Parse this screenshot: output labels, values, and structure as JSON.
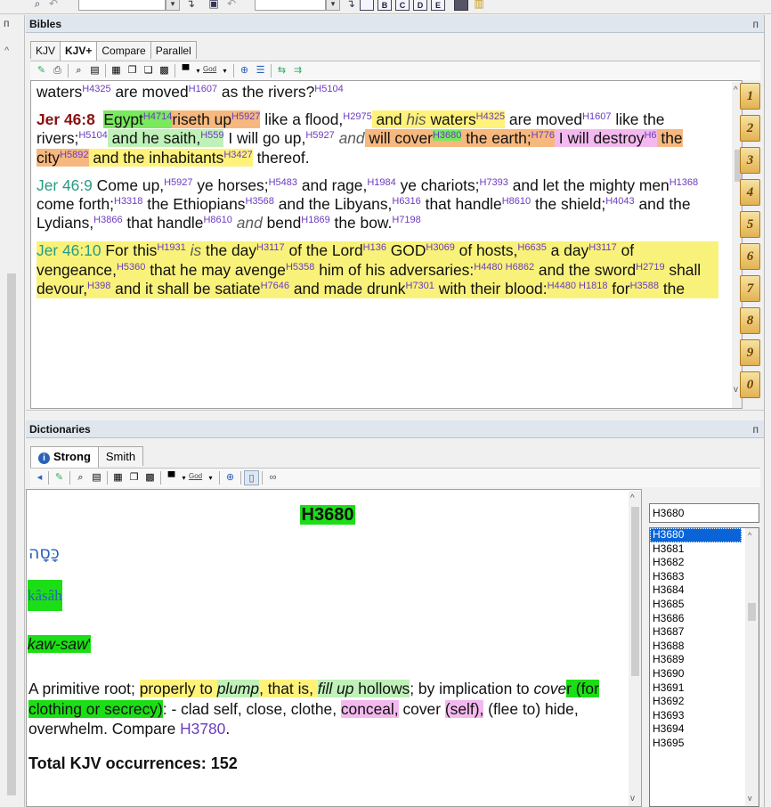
{
  "bibles_panel": {
    "title": "Bibles",
    "pin_glyph": "ᴨ",
    "tabs": [
      "KJV",
      "KJV+",
      "Compare",
      "Parallel"
    ],
    "god_label": "God",
    "verse_prev_tail": {
      "t1": "waters",
      "s1": "H4325",
      "t2": " are moved",
      "s2": "H1607",
      "t3": " as the rivers?",
      "s3": "H5104"
    },
    "v8": {
      "ref": "Jer 46:8",
      "p1": "Egypt",
      "p1s": "H4714",
      "p2": "riseth up",
      "p2s": "H5927",
      "p3": " like a flood,",
      "p3s": "H2975",
      "p4a": " and ",
      "p4b": "his",
      "p4c": " waters",
      "p4s": "H4325",
      "p5": " are moved",
      "p5s": "H1607",
      "p6": " like the rivers;",
      "p6s": "H5104",
      "p7": " and he saith,",
      "p7s": "H559",
      "p8": " I will go up,",
      "p8s": "H5927",
      "p9": " and",
      "p10": " will cover",
      "p10s": "H3680",
      "p11": " the earth;",
      "p11s": "H776",
      "p12": " I will destroy",
      "p12s": "H6",
      "p13": " the city",
      "p13s": "H5892",
      "p14": " and the inhabitants",
      "p14s": "H3427",
      "p15": " thereof."
    },
    "v9": {
      "ref": "Jer 46:9",
      "text_a": "  Come up,",
      "sa": "H5927",
      "text_b": " ye horses;",
      "sb": "H5483",
      "text_c": " and rage,",
      "sc": "H1984",
      "text_d": " ye chariots;",
      "sd": "H7393",
      "text_e": " and let the mighty men",
      "se": "H1368",
      "text_f": " come forth;",
      "sf": "H3318",
      "text_g": " the Ethiopians",
      "sg": "H3568",
      "text_h": " and the Libyans,",
      "sh": "H6316",
      "text_i": " that handle",
      "si": "H8610",
      "text_j": " the shield;",
      "sj": "H4043",
      "text_k": " and the Lydians,",
      "sk": "H3866",
      "text_l": " that handle",
      "sl": "H8610",
      "text_m": "and",
      "text_n": " bend",
      "sn": "H1869",
      "text_o": " the bow.",
      "so": "H7198"
    },
    "v10": {
      "ref": "Jer 46:10",
      "a": "  For this",
      "sa": "H1931",
      "b": "is",
      "c": " the day",
      "sc": "H3117",
      "d": " of the Lord",
      "sd": "H136",
      "e": " GOD",
      "se": "H3069",
      "f": " of hosts,",
      "sf": "H6635",
      "g": " a day",
      "sg": "H3117",
      "h": " of vengeance,",
      "sh": "H5360",
      "i": " that he may avenge",
      "si": "H5358",
      "j": " him of his adversaries:",
      "sj": "H4480 H6862",
      "k": " and the sword",
      "sk": "H2719",
      "l": " shall devour,",
      "sl": "H398",
      "m": " and it shall be satiate",
      "sm": "H7646",
      "n": " and made drunk",
      "sn": "H7301",
      "o": " with their blood:",
      "so": "H4480 H1818",
      "p": " for",
      "sp": "H3588",
      "q": " the"
    },
    "verse_buttons": [
      "1",
      "2",
      "3",
      "4",
      "5",
      "6",
      "7",
      "8",
      "9",
      "0"
    ]
  },
  "dict_panel": {
    "title": "Dictionaries",
    "tabs": [
      "Strong",
      "Smith"
    ],
    "info_glyph": "i",
    "entry_id": "H3680",
    "hebrew": "כָּסָה",
    "translit": "kâsâh",
    "pronunciation": "kaw-saw",
    "pron_mark": "'",
    "definition": {
      "a": "A primitive root; ",
      "b": "properly to ",
      "c": "plump",
      "d": ", that is, ",
      "e": "fill up",
      "f": " hollows",
      "g": "; by implication to ",
      "h": "cove",
      "i": "r (for clothing or secrecy)",
      "j": ": - clad self, close, clothe, ",
      "k": "conceal,",
      "l": " cover ",
      "m": "(self),",
      "n": " (flee to) hide, overwhelm. Compare ",
      "o": "H3780",
      "p": "."
    },
    "total": "Total KJV occurrences: 152",
    "search_value": "H3680",
    "list": [
      "H3680",
      "H3681",
      "H3682",
      "H3683",
      "H3684",
      "H3685",
      "H3686",
      "H3687",
      "H3688",
      "H3689",
      "H3690",
      "H3691",
      "H3692",
      "H3693",
      "H3694",
      "H3695"
    ],
    "selected_index": 0
  },
  "toolbar_top": {
    "buttons": [
      "B",
      "C",
      "D",
      "E"
    ]
  },
  "colors": {
    "yellow": "#fff27a",
    "green": "#1cde16",
    "lightgreen": "#bff1b8",
    "orange": "#f6b87e",
    "pink": "#f3b9ee",
    "strong": "#6c3bc1"
  }
}
